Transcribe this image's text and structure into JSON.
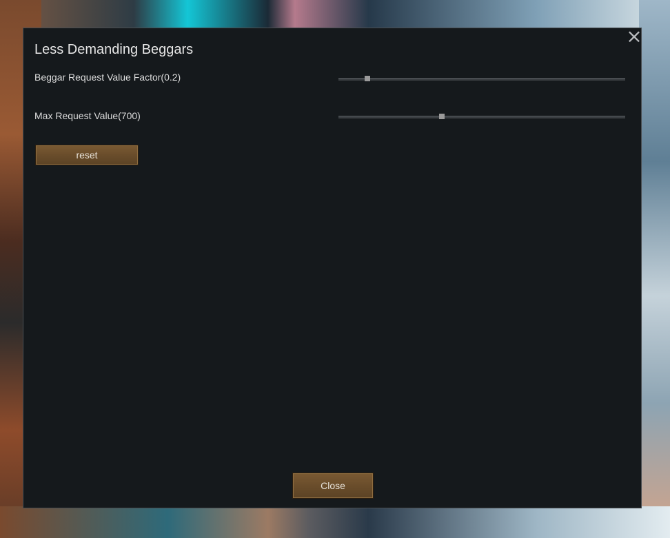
{
  "dialog": {
    "title": "Less Demanding Beggars",
    "settings": [
      {
        "label": "Beggar Request Value Factor(0.2)",
        "slider_fraction": 0.1
      },
      {
        "label": "Max Request Value(700)",
        "slider_fraction": 0.36
      }
    ],
    "reset_label": "reset",
    "close_label": "Close",
    "close_icon": "×"
  }
}
